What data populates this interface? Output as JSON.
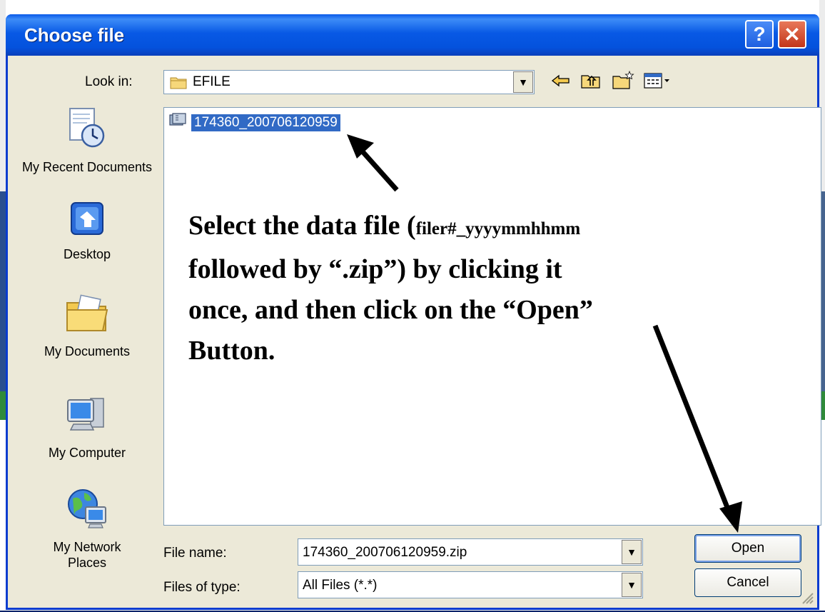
{
  "dialog": {
    "title": "Choose file",
    "help_label": "?",
    "close_label": "✕",
    "look_in_label": "Look in:",
    "look_in_value": "EFILE",
    "file_name_label": "File name:",
    "file_name_value": "174360_200706120959.zip",
    "files_of_type_label": "Files of type:",
    "files_of_type_value": "All Files (*.*)",
    "open_label": "Open",
    "cancel_label": "Cancel"
  },
  "places": [
    {
      "label": "My Recent Documents",
      "icon": "recent-documents-icon"
    },
    {
      "label": "Desktop",
      "icon": "desktop-icon"
    },
    {
      "label": "My Documents",
      "icon": "my-documents-icon"
    },
    {
      "label": "My Computer",
      "icon": "my-computer-icon"
    },
    {
      "label": "My Network Places",
      "icon": "network-places-icon"
    }
  ],
  "files": [
    {
      "name": "174360_200706120959",
      "selected": true
    }
  ],
  "toolbar_icons": [
    "back-icon",
    "up-folder-icon",
    "new-folder-icon",
    "view-menu-icon"
  ],
  "annotation": {
    "line1_a": "Select the data file (",
    "line1_b": "filer#_yyyymmhhmm",
    "line2": "followed by “.zip”) by clicking it",
    "line3": "once, and then click on the “Open”",
    "line4": "Button."
  }
}
